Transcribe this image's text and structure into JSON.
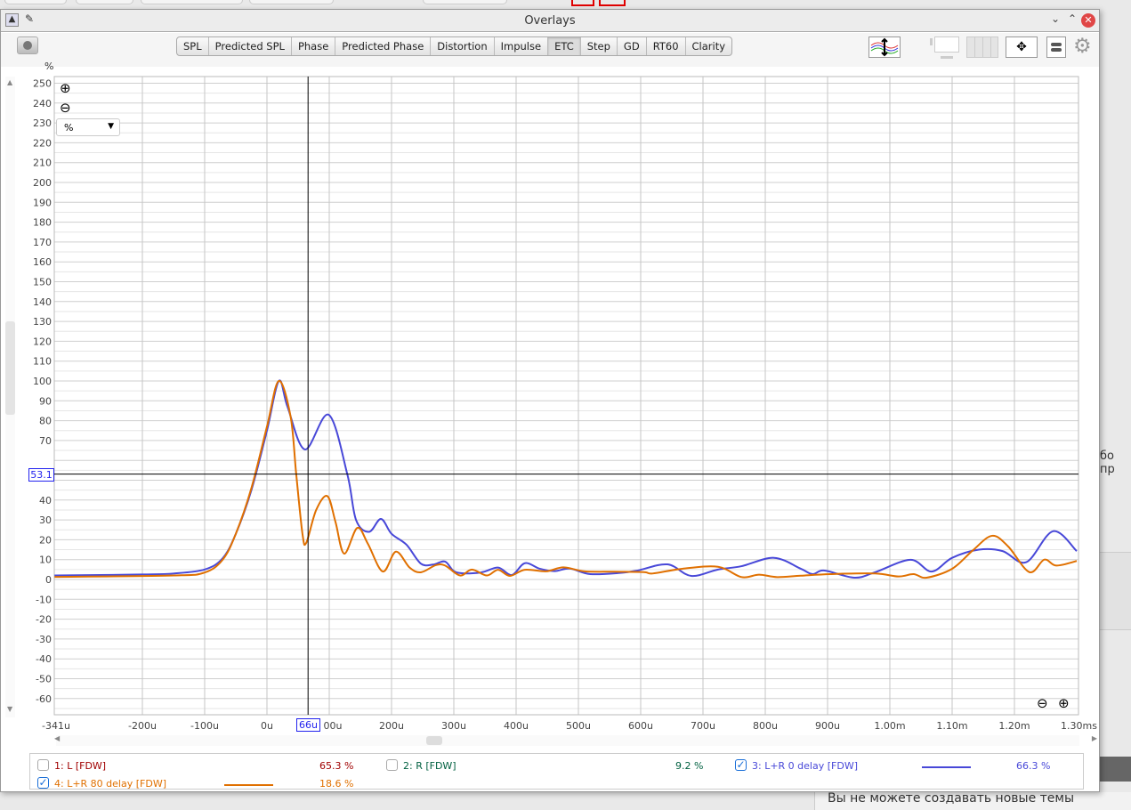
{
  "window": {
    "title": "Overlays"
  },
  "background": {
    "side_text": "бо пр",
    "footer_text": "Вы не можете создавать новые темы"
  },
  "toolbar": {
    "tabs": [
      {
        "label": "SPL"
      },
      {
        "label": "Predicted SPL"
      },
      {
        "label": "Phase"
      },
      {
        "label": "Predicted Phase"
      },
      {
        "label": "Distortion"
      },
      {
        "label": "Impulse"
      },
      {
        "label": "ETC",
        "active": true
      },
      {
        "label": "Step"
      },
      {
        "label": "GD"
      },
      {
        "label": "RT60"
      },
      {
        "label": "Clarity"
      }
    ]
  },
  "plot": {
    "y_unit": "%",
    "unit_select": "%",
    "cursor_x_label": "66u",
    "cursor_y_label": "53.1"
  },
  "legend": [
    {
      "label": "1: L [FDW]",
      "value": "65.3 %",
      "checked": false,
      "color": "#a00000"
    },
    {
      "label": "2: R [FDW]",
      "value": "9.2 %",
      "checked": false,
      "color": "#006040"
    },
    {
      "label": "3: L+R 0 delay [FDW]",
      "value": "66.3 %",
      "checked": true,
      "color": "#4848d8"
    },
    {
      "label": "4: L+R  80 delay [FDW]",
      "value": "18.6 %",
      "checked": true,
      "color": "#e07000"
    }
  ],
  "chart_data": {
    "type": "line",
    "title": "ETC",
    "xlabel": "time",
    "ylabel": "%",
    "xlim": [
      -341,
      1300
    ],
    "ylim": [
      -67,
      255
    ],
    "grid": true,
    "x_ticks": [
      {
        "v": -341,
        "label": "-341u"
      },
      {
        "v": -200,
        "label": "-200u"
      },
      {
        "v": -100,
        "label": "-100u"
      },
      {
        "v": 0,
        "label": "0u"
      },
      {
        "v": 100,
        "label": "00u"
      },
      {
        "v": 200,
        "label": "200u"
      },
      {
        "v": 300,
        "label": "300u"
      },
      {
        "v": 400,
        "label": "400u"
      },
      {
        "v": 500,
        "label": "500u"
      },
      {
        "v": 600,
        "label": "600u"
      },
      {
        "v": 700,
        "label": "700u"
      },
      {
        "v": 800,
        "label": "800u"
      },
      {
        "v": 900,
        "label": "900u"
      },
      {
        "v": 1000,
        "label": "1.00m"
      },
      {
        "v": 1100,
        "label": "1.10m"
      },
      {
        "v": 1200,
        "label": "1.20m"
      },
      {
        "v": 1300,
        "label": "1.30ms"
      }
    ],
    "y_ticks": [
      250,
      240,
      230,
      220,
      210,
      200,
      190,
      180,
      170,
      160,
      150,
      140,
      130,
      120,
      110,
      100,
      90,
      80,
      70,
      40,
      30,
      20,
      10,
      0,
      -10,
      -20,
      -30,
      -40,
      -50,
      -60
    ],
    "cursor": {
      "x": 66,
      "y": 53.1
    },
    "series": [
      {
        "name": "3: L+R 0 delay [FDW]",
        "color": "#4848d8",
        "points": [
          [
            -341,
            2
          ],
          [
            -200,
            2.5
          ],
          [
            -150,
            3
          ],
          [
            -100,
            5
          ],
          [
            -71,
            10.7
          ],
          [
            -50,
            23
          ],
          [
            -25,
            45
          ],
          [
            0,
            75
          ],
          [
            19,
            100
          ],
          [
            33,
            87
          ],
          [
            61,
            65.5
          ],
          [
            99,
            83
          ],
          [
            129,
            53
          ],
          [
            143,
            30
          ],
          [
            164,
            24
          ],
          [
            183,
            30.5
          ],
          [
            200,
            23
          ],
          [
            224,
            17.5
          ],
          [
            247,
            8
          ],
          [
            267,
            7.5
          ],
          [
            286,
            9
          ],
          [
            304,
            3.6
          ],
          [
            343,
            3.5
          ],
          [
            371,
            6
          ],
          [
            393,
            2.2
          ],
          [
            414,
            8.2
          ],
          [
            438,
            5.4
          ],
          [
            462,
            4.2
          ],
          [
            486,
            5.5
          ],
          [
            519,
            2.7
          ],
          [
            567,
            3.3
          ],
          [
            595,
            4.5
          ],
          [
            643,
            7.6
          ],
          [
            681,
            1.8
          ],
          [
            724,
            5
          ],
          [
            762,
            6.7
          ],
          [
            814,
            10.9
          ],
          [
            857,
            5.4
          ],
          [
            876,
            2.7
          ],
          [
            895,
            4.5
          ],
          [
            943,
            0.9
          ],
          [
            976,
            3.6
          ],
          [
            1033,
            9.9
          ],
          [
            1067,
            4
          ],
          [
            1100,
            10.9
          ],
          [
            1143,
            15
          ],
          [
            1181,
            14.3
          ],
          [
            1219,
            8.7
          ],
          [
            1262,
            24.3
          ],
          [
            1300,
            14.3
          ]
        ]
      },
      {
        "name": "4: L+R  80 delay [FDW]",
        "color": "#e07000",
        "points": [
          [
            -341,
            1.3
          ],
          [
            -150,
            2
          ],
          [
            -100,
            3.5
          ],
          [
            -71,
            10
          ],
          [
            -50,
            23
          ],
          [
            -25,
            46
          ],
          [
            0,
            77
          ],
          [
            19,
            100
          ],
          [
            38,
            82
          ],
          [
            47,
            53
          ],
          [
            57,
            23
          ],
          [
            63,
            18.4
          ],
          [
            79,
            35
          ],
          [
            97,
            42
          ],
          [
            110,
            29
          ],
          [
            124,
            13
          ],
          [
            145,
            26
          ],
          [
            162,
            18
          ],
          [
            186,
            4
          ],
          [
            207,
            14
          ],
          [
            229,
            6
          ],
          [
            247,
            3.6
          ],
          [
            271,
            7.2
          ],
          [
            286,
            7
          ],
          [
            310,
            2
          ],
          [
            329,
            5
          ],
          [
            353,
            2
          ],
          [
            371,
            4.9
          ],
          [
            390,
            1.8
          ],
          [
            414,
            4.9
          ],
          [
            448,
            4.1
          ],
          [
            476,
            6.1
          ],
          [
            510,
            4.1
          ],
          [
            557,
            3.9
          ],
          [
            605,
            3.7
          ],
          [
            619,
            3
          ],
          [
            667,
            5.4
          ],
          [
            724,
            6.4
          ],
          [
            762,
            1.2
          ],
          [
            790,
            2.4
          ],
          [
            819,
            1.2
          ],
          [
            857,
            1.9
          ],
          [
            905,
            2.7
          ],
          [
            976,
            3
          ],
          [
            1014,
            1.5
          ],
          [
            1038,
            2.7
          ],
          [
            1059,
            0.9
          ],
          [
            1100,
            5.4
          ],
          [
            1133,
            14.6
          ],
          [
            1164,
            22
          ],
          [
            1190,
            16.6
          ],
          [
            1224,
            3.7
          ],
          [
            1248,
            10
          ],
          [
            1267,
            7
          ],
          [
            1300,
            9.3
          ]
        ]
      }
    ]
  }
}
